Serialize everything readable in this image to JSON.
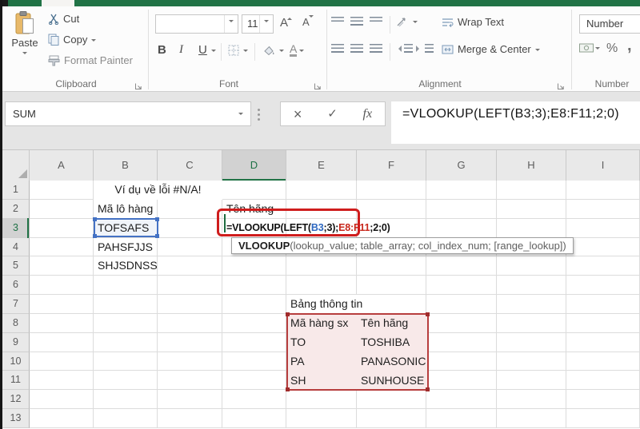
{
  "ribbon": {
    "groups": {
      "clipboard": {
        "label": "Clipboard",
        "paste": "Paste",
        "cut": "Cut",
        "copy": "Copy",
        "format_painter": "Format Painter"
      },
      "font": {
        "label": "Font",
        "font_name": "",
        "font_size": "11",
        "bold": "B",
        "italic": "I",
        "underline": "U",
        "grow_font": "A",
        "shrink_font": "A",
        "font_color": "A"
      },
      "alignment": {
        "label": "Alignment",
        "wrap_text": "Wrap Text",
        "merge_center": "Merge & Center"
      },
      "number": {
        "label": "Number",
        "format_selected": "Number",
        "percent": "%",
        "comma": ","
      }
    }
  },
  "formula_bar": {
    "name_box": "SUM",
    "cancel": "×",
    "enter": "✓",
    "insert_function": "fx",
    "formula": "=VLOOKUP(LEFT(B3;3);E8:F11;2;0)"
  },
  "grid": {
    "columns": [
      "A",
      "B",
      "C",
      "D",
      "E",
      "F",
      "G",
      "H",
      "I"
    ],
    "row_count": 13,
    "active_column": "D",
    "active_row": 3,
    "cells": [
      {
        "ref": "B1",
        "text": "Ví dụ về lỗi #N/A!",
        "span": 2,
        "align": "center",
        "bg": true
      },
      {
        "ref": "B2",
        "text": "Mã lô hàng"
      },
      {
        "ref": "D2",
        "text": "Tên hãng"
      },
      {
        "ref": "B3",
        "text": "TOFSAFS"
      },
      {
        "ref": "B4",
        "text": "PAHSFJJS"
      },
      {
        "ref": "B5",
        "text": "SHJSDNSS"
      },
      {
        "ref": "E7",
        "text": "Bảng thông tin",
        "bg": true
      },
      {
        "ref": "E8",
        "text": "Mã hàng sx"
      },
      {
        "ref": "F8",
        "text": "Tên hãng"
      },
      {
        "ref": "E9",
        "text": "TO"
      },
      {
        "ref": "F9",
        "text": "TOSHIBA"
      },
      {
        "ref": "E10",
        "text": "PA"
      },
      {
        "ref": "F10",
        "text": "PANASONIC"
      },
      {
        "ref": "E11",
        "text": "SH"
      },
      {
        "ref": "F11",
        "text": "SUNHOUSE"
      }
    ]
  },
  "editing_cell": {
    "ref": "D3",
    "formula_pre": "=VLOOKUP(LEFT(",
    "formula_ref1": "B3",
    "formula_mid": ";3);",
    "formula_ref2": "E8:F11",
    "formula_post": ";2;0)"
  },
  "function_tooltip": {
    "name": "VLOOKUP",
    "signature": "(lookup_value; table_array; col_index_num; [range_lookup])"
  },
  "colors": {
    "excel_green": "#217346",
    "reference_blue": "#2e68c0",
    "reference_red": "#c8281c",
    "annotation_red": "#cf1d1d",
    "range_fill": "#f8e9e9",
    "selection_blue": "#4472c4"
  }
}
